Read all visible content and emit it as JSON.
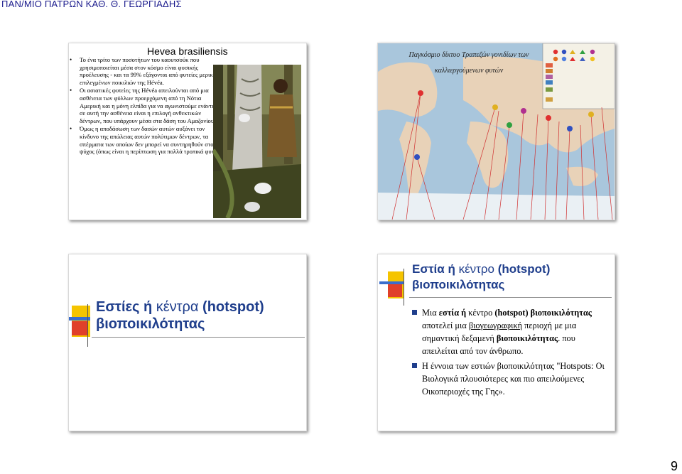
{
  "header": "ΠΑΝ/ΜΙΟ ΠΑΤΡΩΝ ΚΑΘ. Θ. ΓΕΩΡΓΙΑΔΗΣ",
  "slide1": {
    "title": "Hevea brasiliensis",
    "bullets": [
      "Το ένα τρίτο των ποσοτήτων του καουτσούκ που χρησιμοποιείται μέσα στον κόσμο είναι φυσικής προέλευσης - και τα 99% εξάγονται από φυτείες μερικών επιλεγμένων ποικιλιών της Hévéa.",
      "Οι ασιατικές φυτείες της Hévéa απειλούνται από μια ασθένεια των φύλλων προερχόμενη από τη Νότια Αμερική και η μόνη ελπίδα για να αγωνιστούμε ενάντια σε αυτή την ασθένεια είναι η επιλογή ανθεκτικών δέντρων, που υπάρχουν μέσα στα δάση του Αμαζονίου.",
      "Όμως η αποδάσωση των δασών αυτών αυξάνει τον κίνδυνο της απώλειας αυτών πολύτιμων δέντρων, τα σπέρματα των οποίων δεν μπορεί να συντηρηθούν στο ψύχος (όπως είναι η περίπτωση για πολλά τροπικά φυτά )"
    ]
  },
  "slide2": {
    "title_line1": "Παγκόσμιο δίκτυο Τραπεζών γονιδίων των",
    "title_line2": "καλλιεργούμενων φυτών"
  },
  "slide3": {
    "title_bold1": "Εστίες ή",
    "title_plain": " κέντρα ",
    "title_bold2": "(hotspot) βιοποικιλότητας"
  },
  "slide4": {
    "title_plain1": "Εστία ή",
    "title_plain2": " κέντρο ",
    "title_bold": "(hotspot) βιοποικιλότητας",
    "para1": {
      "t1": "Μια ",
      "t2": "εστία ή",
      "t3": " κέντρο ",
      "t4": "(hotspot) βιοποικιλότητας",
      "t5": " αποτελεί μια ",
      "t6": "βιογεωγραφική",
      "t7": " περιοχή με μια σημαντική δεξαμενή ",
      "t8": "βιοποικιλότητας",
      "t9": ". που απειλείται από τον άνθρωπο."
    },
    "para2": "Η έννοια των εστιών βιοποικιλότητας \"Hotspots: Οι Βιολογικά πλουσιότερες και πιο απειλούμενες Οικοπεριοχές της Γης»."
  },
  "page_number": "9",
  "colors": {
    "title_blue": "#1f3e8c",
    "header_blue": "#1a1a8c",
    "accent_yellow": "#f5c400",
    "accent_red": "#e0402a"
  }
}
